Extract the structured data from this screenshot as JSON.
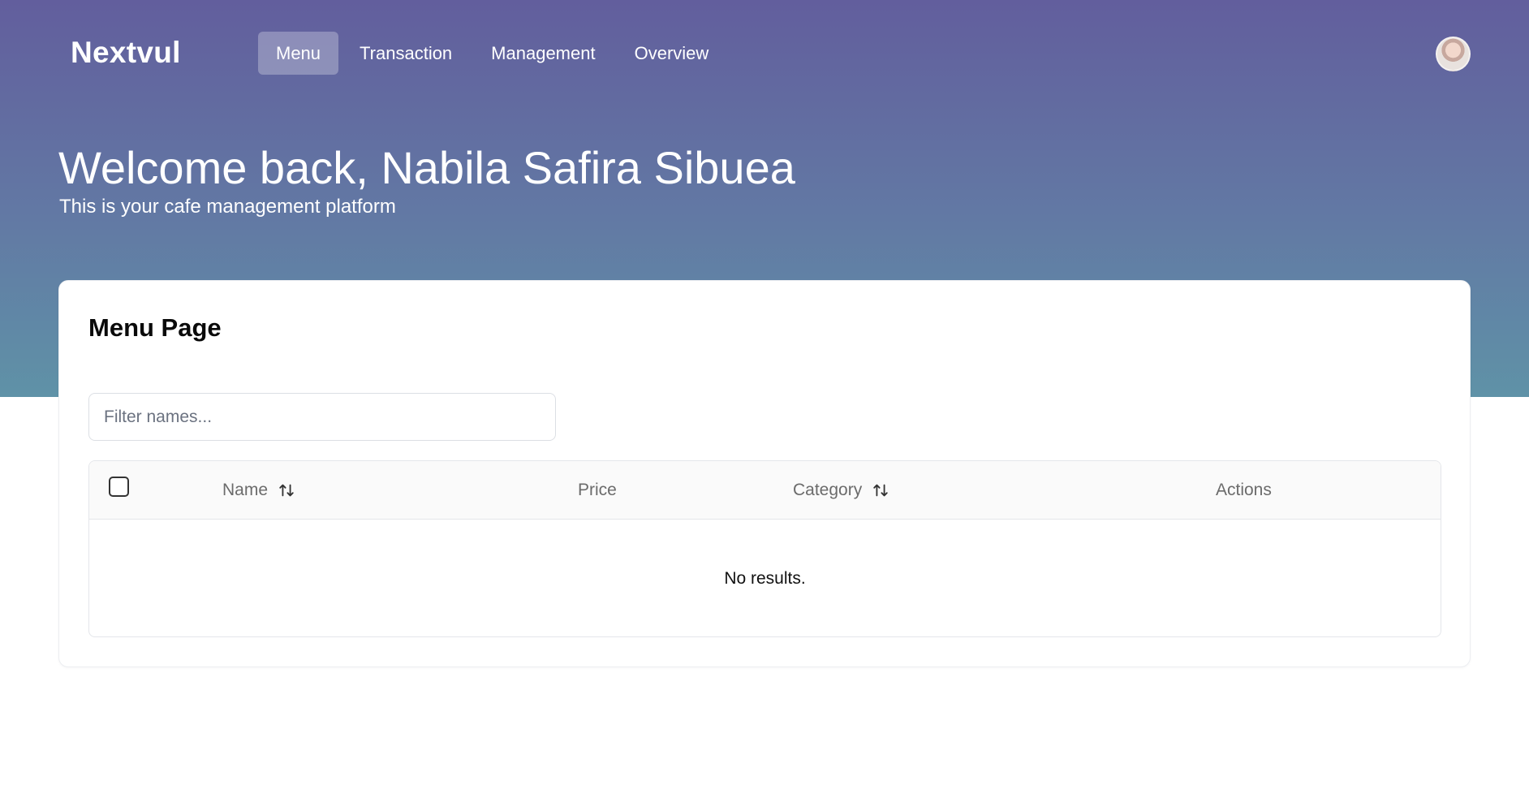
{
  "app": {
    "brand": "Nextvul"
  },
  "nav": {
    "items": [
      {
        "label": "Menu",
        "active": true
      },
      {
        "label": "Transaction",
        "active": false
      },
      {
        "label": "Management",
        "active": false
      },
      {
        "label": "Overview",
        "active": false
      }
    ]
  },
  "user": {
    "avatar_icon": "user-avatar"
  },
  "hero": {
    "title": "Welcome back, Nabila Safira Sibuea",
    "subtitle": "This is your cafe management platform"
  },
  "page": {
    "title": "Menu Page",
    "filter": {
      "placeholder": "Filter names...",
      "value": ""
    },
    "table": {
      "columns": [
        {
          "label": "Name",
          "sortable": true
        },
        {
          "label": "Price",
          "sortable": false
        },
        {
          "label": "Category",
          "sortable": true
        },
        {
          "label": "Actions",
          "sortable": false
        }
      ],
      "empty_text": "No results.",
      "select_all_checked": false
    }
  },
  "colors": {
    "hero_top": "#625e9d",
    "hero_bottom": "#5f92a7",
    "nav_active_bg": "rgba(255,255,255,0.28)"
  }
}
